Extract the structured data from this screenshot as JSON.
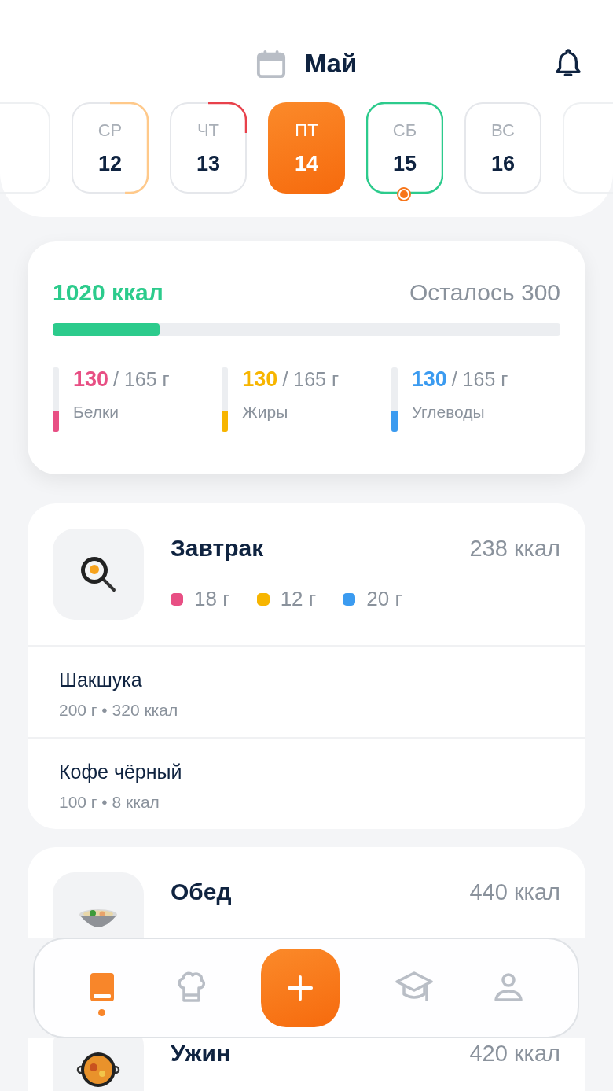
{
  "header": {
    "month": "Май"
  },
  "days": [
    {
      "weekday": "СР",
      "date": "12",
      "selected": false,
      "kind": "half",
      "color": "#ffc98a",
      "today": false
    },
    {
      "weekday": "ЧТ",
      "date": "13",
      "selected": false,
      "kind": "quarter",
      "color": "#e8414b",
      "today": false
    },
    {
      "weekday": "ПТ",
      "date": "14",
      "selected": true,
      "today": false
    },
    {
      "weekday": "СБ",
      "date": "15",
      "selected": false,
      "kind": "full",
      "color": "#2ccb8c",
      "today": true
    },
    {
      "weekday": "ВС",
      "date": "16",
      "selected": false,
      "kind": "plain",
      "today": false
    }
  ],
  "summary": {
    "calories": "1020 ккал",
    "remaining": "Осталось 300",
    "level": 0.21,
    "macros": [
      {
        "value": "130",
        "total": "/ 165 г",
        "label": "Белки",
        "color": "#e84f84",
        "level": 0.32
      },
      {
        "value": "130",
        "total": "/ 165 г",
        "label": "Жиры",
        "color": "#f7b500",
        "level": 0.32
      },
      {
        "value": "130",
        "total": "/ 165 г",
        "label": "Углеводы",
        "color": "#3b9bf0",
        "level": 0.32
      }
    ]
  },
  "meals": [
    {
      "title": "Завтрак",
      "calories": "238 ккал",
      "macros": [
        {
          "value": "18 г",
          "color": "#e84f84"
        },
        {
          "value": "12 г",
          "color": "#f7b500"
        },
        {
          "value": "20 г",
          "color": "#3b9bf0"
        }
      ],
      "items": [
        {
          "name": "Шакшука",
          "details": "200 г • 320 ккал"
        },
        {
          "name": "Кофе чёрный",
          "details": "100 г • 8 ккал"
        }
      ]
    },
    {
      "title": "Обед",
      "calories": "440 ккал"
    },
    {
      "title": "Ужин",
      "calories": "420 ккал"
    }
  ],
  "nav": {
    "tabs": [
      {
        "selected": true
      },
      {
        "selected": false
      },
      {
        "selected": false
      },
      {
        "selected": false
      }
    ]
  }
}
